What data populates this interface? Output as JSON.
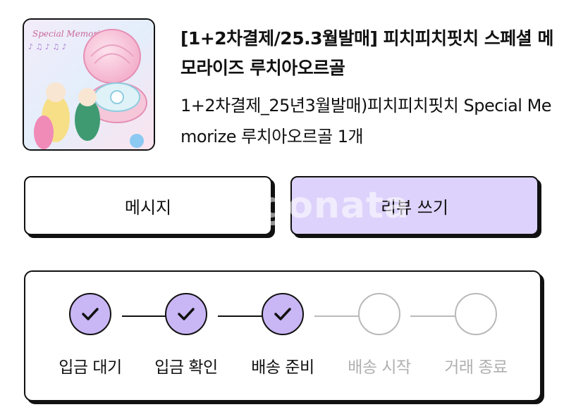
{
  "product": {
    "image_alt": "Special Memorize 루치아 오르골 제품 이미지",
    "image_text": "Special Memorize",
    "title": "[1+2차결제/25.3월발매] 피치피치핏치 스페셜 메모라이즈 루치아오르골",
    "option": "1+2차결제_25년3월발매)피치피치핏치 Special Memorize 루치아오르골 1개"
  },
  "actions": {
    "message_label": "메시지",
    "review_label": "리뷰 쓰기"
  },
  "progress": {
    "steps": [
      {
        "label": "입금 대기",
        "status": "done"
      },
      {
        "label": "입금 확인",
        "status": "done"
      },
      {
        "label": "배송 준비",
        "status": "done"
      },
      {
        "label": "배송 시작",
        "status": "pending"
      },
      {
        "label": "거래 종료",
        "status": "pending"
      }
    ]
  },
  "colors": {
    "accent_light": "#ddd2fb",
    "step_done": "#c9b6f5",
    "step_pending_border": "#b9b9b9",
    "step_pending_text": "#b0b0b0"
  },
  "watermark": "gonata"
}
